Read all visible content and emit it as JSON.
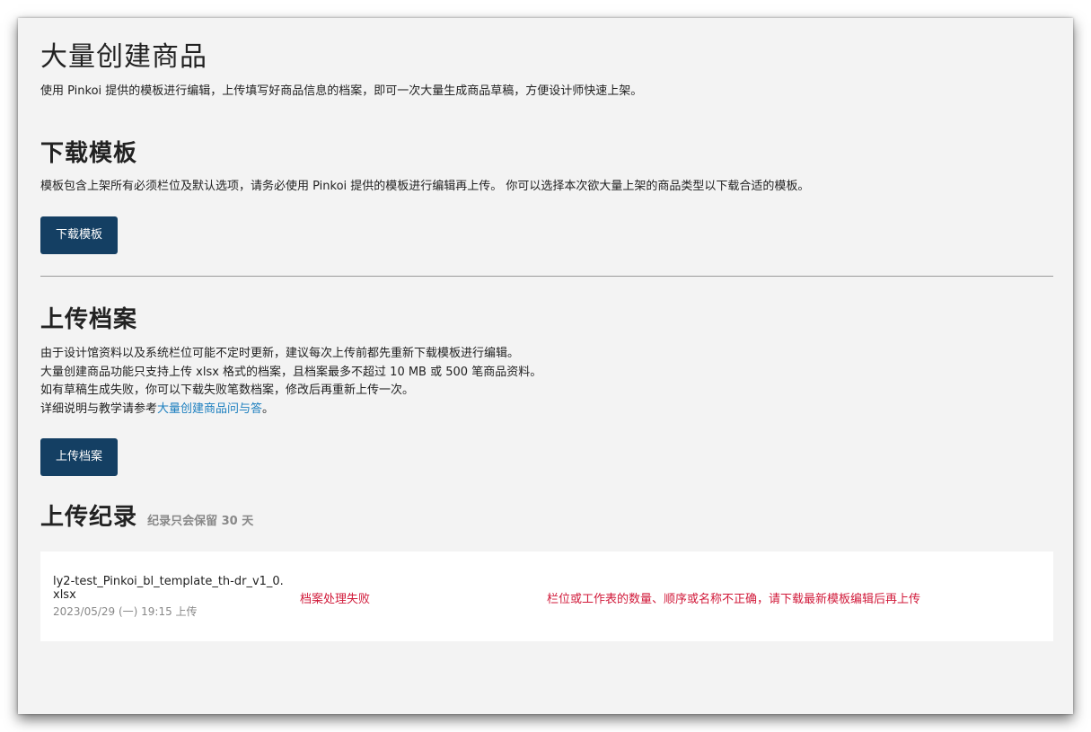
{
  "page": {
    "title": "大量创建商品",
    "intro": "使用 Pinkoi 提供的模板进行编辑，上传填写好商品信息的档案，即可一次大量生成商品草稿，方便设计师快速上架。"
  },
  "download": {
    "heading": "下载模板",
    "description": "模板包含上架所有必须栏位及默认选项，请务必使用 Pinkoi 提供的模板进行编辑再上传。 你可以选择本次欲大量上架的商品类型以下载合适的模板。",
    "button_label": "下载模板"
  },
  "upload": {
    "heading": "上传档案",
    "lines": [
      "由于设计馆资料以及系统栏位可能不定时更新，建议每次上传前都先重新下载模板进行编辑。",
      "大量创建商品功能只支持上传 xlsx 格式的档案，且档案最多不超过 10 MB 或 500 笔商品资料。",
      "如有草稿生成失败，你可以下载失败笔数档案，修改后再重新上传一次。"
    ],
    "help_prefix": "详细说明与教学请参考",
    "help_link": "大量创建商品问与答",
    "help_suffix": "。",
    "button_label": "上传档案"
  },
  "history": {
    "heading": "上传纪录",
    "note": "纪录只会保留 30 天",
    "records": [
      {
        "filename": "ly2-test_Pinkoi_bl_template_th-dr_v1_0.xlsx",
        "timestamp": "2023/05/29 (一) 19:15 上传",
        "status": "档案处理失败",
        "message": "栏位或工作表的数量、顺序或名称不正确，请下载最新模板编辑后再上传"
      }
    ]
  },
  "colors": {
    "button": "#143f63",
    "error": "#d11a3a",
    "link": "#1c7fbf",
    "background": "#f3f3f3"
  }
}
